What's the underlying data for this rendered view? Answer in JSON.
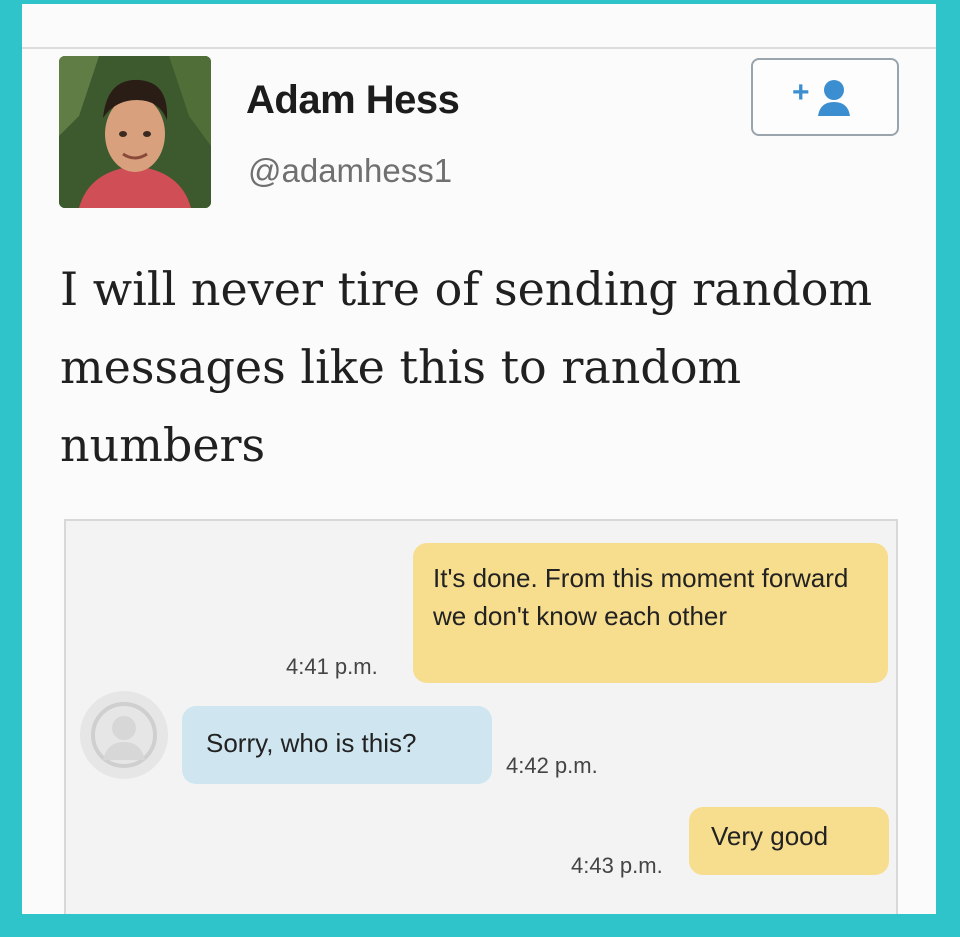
{
  "tweet": {
    "author_name": "Adam Hess",
    "author_handle": "@adamhess1",
    "text": "I will never tire of sending random messages like this to random numbers",
    "follow_button_icon": "add-user-icon"
  },
  "conversation": {
    "messages": [
      {
        "direction": "sent",
        "text": "It's done. From this moment forward we don't know each other",
        "time": "4:41 p.m."
      },
      {
        "direction": "received",
        "text": "Sorry, who is this?",
        "time": "4:42 p.m."
      },
      {
        "direction": "sent",
        "text": "Very good",
        "time": "4:43 p.m."
      }
    ]
  },
  "colors": {
    "frame": "#2ec4c9",
    "sent_bubble": "#f7dd8e",
    "received_bubble": "#cfe6f1"
  }
}
